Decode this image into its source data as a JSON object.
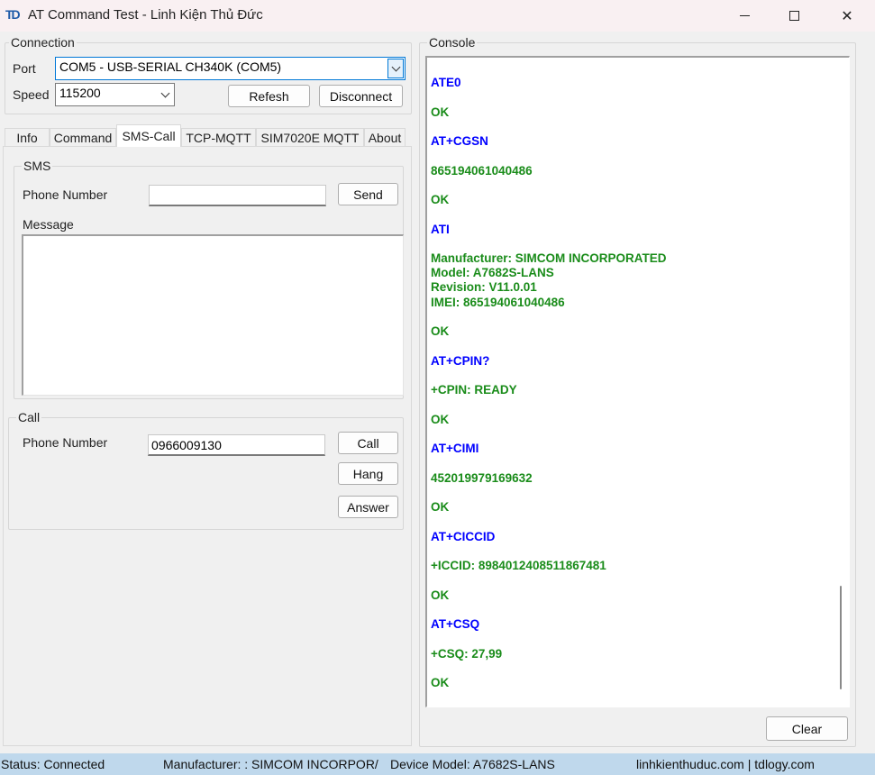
{
  "window": {
    "icon_text": "TD",
    "title": "AT Command Test - Linh Kiện Thủ Đức"
  },
  "connection": {
    "legend": "Connection",
    "port_label": "Port",
    "port_value": "COM5 - USB-SERIAL CH340K (COM5)",
    "speed_label": "Speed",
    "speed_value": "115200",
    "refresh_label": "Refesh",
    "disconnect_label": "Disconnect"
  },
  "tabs": [
    "Info",
    "Command",
    "SMS-Call",
    "TCP-MQTT",
    "SIM7020E MQTT",
    "About"
  ],
  "sms": {
    "legend": "SMS",
    "phone_label": "Phone Number",
    "phone_value": "",
    "send_label": "Send",
    "message_label": "Message",
    "message_value": ""
  },
  "call": {
    "legend": "Call",
    "phone_label": "Phone Number",
    "phone_value": "0966009130",
    "call_label": "Call",
    "hang_label": "Hang",
    "answer_label": "Answer"
  },
  "console": {
    "legend": "Console",
    "clear_label": "Clear",
    "lines": [
      {
        "text": "ATE0",
        "kind": "cmd"
      },
      {
        "text": "OK",
        "kind": "resp"
      },
      {
        "text": "AT+CGSN",
        "kind": "cmd"
      },
      {
        "text": "865194061040486",
        "kind": "resp"
      },
      {
        "text": "OK",
        "kind": "resp"
      },
      {
        "text": "ATI",
        "kind": "cmd"
      },
      {
        "text": "Manufacturer: SIMCOM INCORPORATED",
        "kind": "resp"
      },
      {
        "text": "Model: A7682S-LANS",
        "kind": "resp"
      },
      {
        "text": "Revision: V11.0.01",
        "kind": "resp"
      },
      {
        "text": "IMEI: 865194061040486",
        "kind": "resp"
      },
      {
        "text": "OK",
        "kind": "resp"
      },
      {
        "text": "AT+CPIN?",
        "kind": "cmd"
      },
      {
        "text": "+CPIN: READY",
        "kind": "resp"
      },
      {
        "text": "OK",
        "kind": "resp"
      },
      {
        "text": "AT+CIMI",
        "kind": "cmd"
      },
      {
        "text": "452019979169632",
        "kind": "resp"
      },
      {
        "text": "OK",
        "kind": "resp"
      },
      {
        "text": "AT+CICCID",
        "kind": "cmd"
      },
      {
        "text": "+ICCID: 8984012408511867481",
        "kind": "resp"
      },
      {
        "text": "OK",
        "kind": "resp"
      },
      {
        "text": "AT+CSQ",
        "kind": "cmd"
      },
      {
        "text": "+CSQ: 27,99",
        "kind": "resp"
      },
      {
        "text": "OK",
        "kind": "resp"
      }
    ]
  },
  "status": {
    "status_text": "Status: Connected",
    "manufacturer_text": "Manufacturer: : SIMCOM INCORPOR/",
    "model_text": "Device Model:  A7682S-LANS",
    "site_text": "linhkienthuduc.com | tdlogy.com"
  },
  "colors": {
    "command": "#0000ff",
    "response": "#1a8c1a",
    "statusbar": "#bfd8ec",
    "titlebar": "#f9f0f2"
  }
}
